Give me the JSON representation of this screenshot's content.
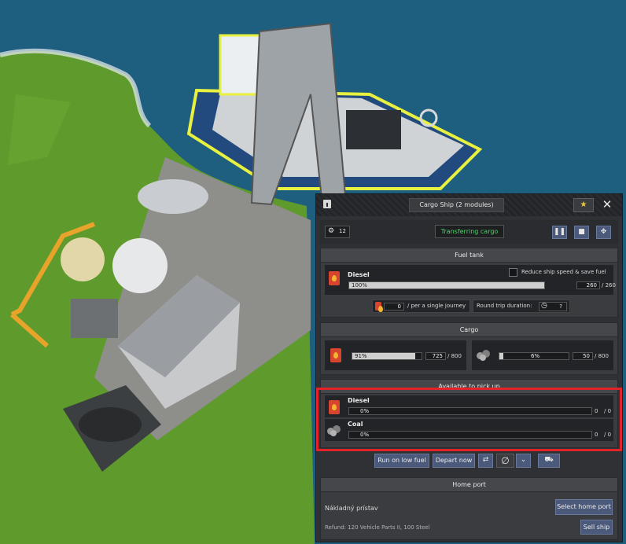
{
  "panel": {
    "title": "Cargo Ship (2 modules)",
    "crew_count": "12",
    "status": "Transferring cargo"
  },
  "fuel_tank": {
    "header": "Fuel tank",
    "product": "Diesel",
    "reduce_label": "Reduce ship speed & save fuel",
    "fill_percent": 100,
    "fill_label": "100%",
    "amount": "260",
    "capacity": "/ 260",
    "journey_amount": "0",
    "journey_label": "/ per a single journey",
    "round_trip_label": "Round trip duration:",
    "round_trip_value": "?"
  },
  "cargo": {
    "header": "Cargo",
    "items": [
      {
        "product": "Diesel",
        "fill_percent": 91,
        "fill_label": "91%",
        "amount": "725",
        "capacity": "/ 800"
      },
      {
        "product": "Coal",
        "fill_percent": 6,
        "fill_label": "6%",
        "amount": "50",
        "capacity": "/ 800"
      }
    ]
  },
  "available": {
    "header": "Available to pick up",
    "items": [
      {
        "product": "Diesel",
        "fill_percent": 0,
        "fill_label": "0%",
        "amount": "0",
        "capacity": "/ 0"
      },
      {
        "product": "Coal",
        "fill_percent": 0,
        "fill_label": "0%",
        "amount": "0",
        "capacity": "/ 0"
      }
    ]
  },
  "actions": {
    "run_low_fuel": "Run on low fuel",
    "depart_now": "Depart now"
  },
  "home_port": {
    "header": "Home port",
    "name": "Nákladný prístav",
    "select_button": "Select home port",
    "refund": "Refund: 120 Vehicle Parts II, 100 Steel",
    "sell_button": "Sell ship"
  },
  "colors": {
    "highlight": "#e3222a",
    "status_text": "#4fd66a",
    "fuel_icon": "#d8452e",
    "selection_glow": "#e8f040"
  },
  "icons": [
    "info-icon",
    "pin-icon",
    "close-icon",
    "worker-icon",
    "pause-icon",
    "camera-icon",
    "move-icon",
    "fuel-can-icon",
    "coal-icon",
    "clock-icon",
    "cycle-icon",
    "no-entry-icon",
    "chevron-down-icon",
    "truck-icon"
  ]
}
